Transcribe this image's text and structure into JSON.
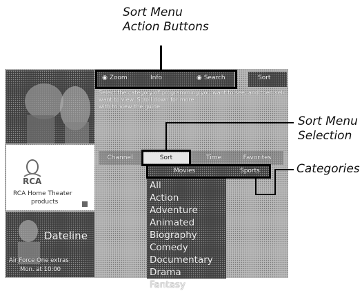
{
  "callouts": {
    "action_buttons": [
      "Sort Menu",
      "Action Buttons"
    ],
    "selection": [
      "Sort Menu",
      "Selection"
    ],
    "categories": "Categories"
  },
  "sidebar": {
    "top_panel_text": "",
    "ad_caption_1": "RCA Home Theater",
    "ad_caption_2": "products",
    "bottom_logo": "Dateline",
    "bottom_caption_1": "Air Force One extras",
    "bottom_caption_2": "Mon. at 10:00"
  },
  "actions": [
    "Zoom",
    "Info",
    "Search"
  ],
  "corner_label": "Sort",
  "info_text": [
    "Select the category of programming you want to see, and then select the title you",
    "want to view. Scroll down for more.",
    "with to view the guide."
  ],
  "tabs": [
    "Channel",
    "Sort",
    "Time",
    "Favorites"
  ],
  "subheaders": [
    "Movies",
    "Sports"
  ],
  "categories": [
    "All",
    "Action",
    "Adventure",
    "Animated",
    "Biography",
    "Comedy",
    "Documentary",
    "Drama",
    "Fantasy"
  ]
}
